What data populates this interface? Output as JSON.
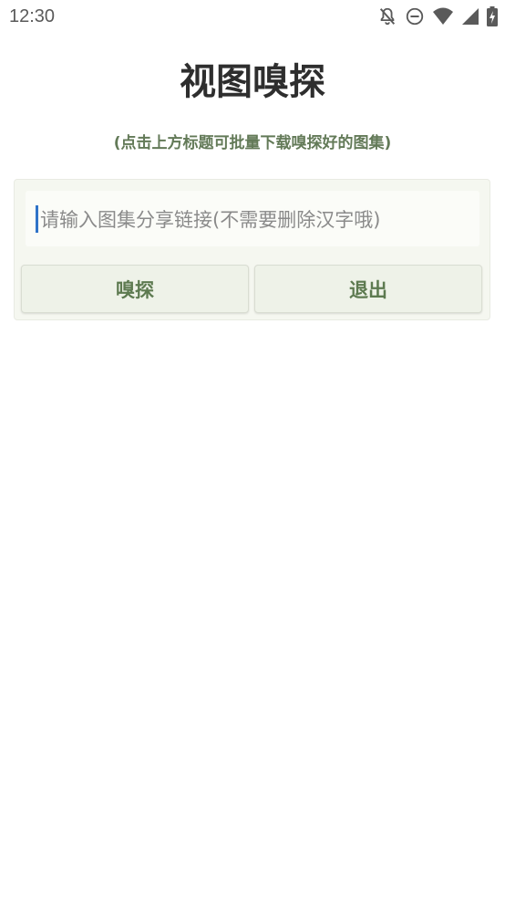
{
  "status_bar": {
    "time": "12:30",
    "icons": [
      "notifications-off-icon",
      "do-not-disturb-icon",
      "wifi-icon",
      "cellular-signal-icon",
      "battery-charging-icon"
    ]
  },
  "header": {
    "title": "视图嗅探",
    "subtitle": "(点击上方标题可批量下载嗅探好的图集)"
  },
  "form": {
    "input_value": "",
    "input_placeholder": "请输入图集分享链接(不需要删除汉字哦)",
    "sniff_label": "嗅探",
    "exit_label": "退出"
  },
  "colors": {
    "accent_text": "#637a58",
    "button_text": "#5d7a50",
    "card_bg": "#f5f7f0",
    "caret": "#2f73c8"
  }
}
